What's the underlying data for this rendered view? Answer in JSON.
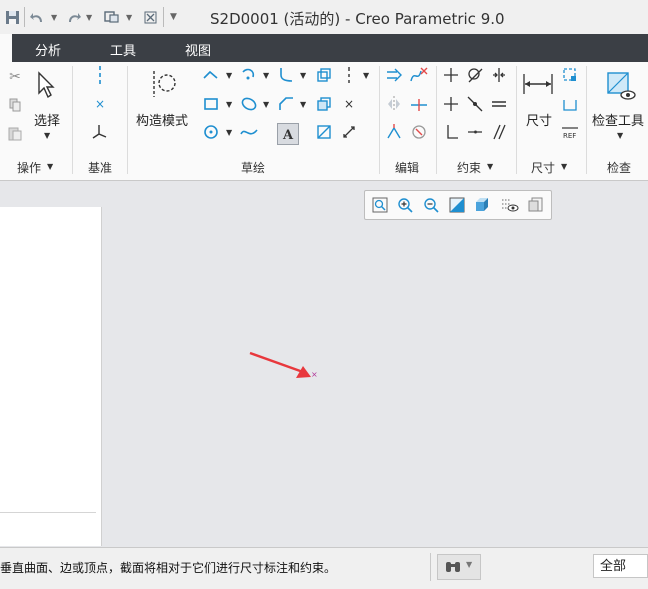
{
  "title": "S2D0001 (活动的) - Creo Parametric 9.0",
  "tabs": [
    "分析",
    "工具",
    "视图"
  ],
  "groups": {
    "operations": "操作",
    "datum": "基准",
    "sketch": "草绘",
    "edit": "编辑",
    "constraint": "约束",
    "dimension": "尺寸",
    "inspect": "检查"
  },
  "buttons": {
    "select": "选择",
    "construction_mode": "构造模式",
    "dimension": "尺寸",
    "inspect_tool": "检查工具"
  },
  "status": {
    "message": "垂直曲面、边或顶点，截面将相对于它们进行尺寸标注和约束。",
    "filter_value": "全部"
  },
  "colors": {
    "accent": "#1f8fd0",
    "tabbar": "#3b3f45",
    "arrow": "#e8383d",
    "point": "#b03a9a"
  }
}
